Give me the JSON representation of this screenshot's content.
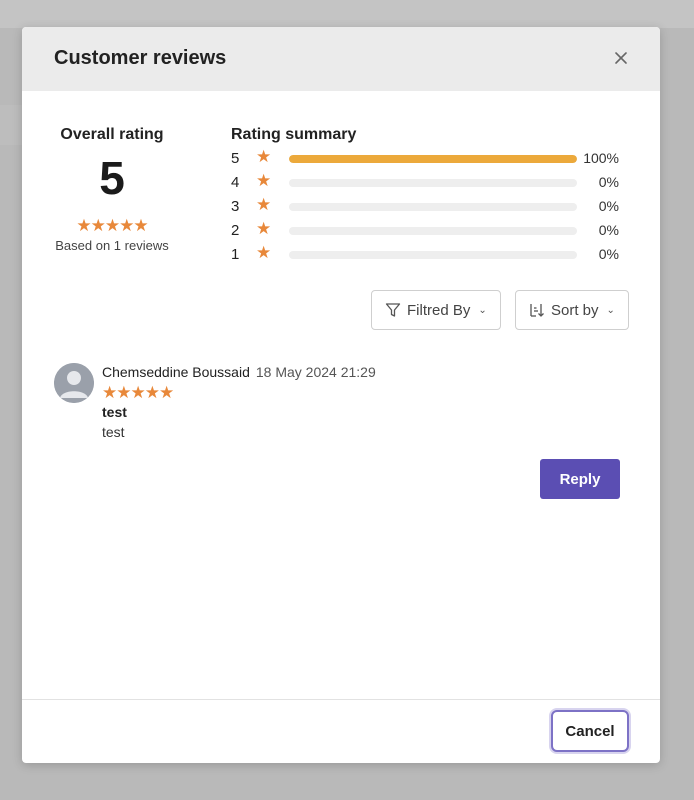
{
  "modal": {
    "title": "Customer reviews",
    "cancel_label": "Cancel"
  },
  "overall": {
    "label": "Overall rating",
    "value": "5",
    "stars": "★★★★★",
    "based_on": "Based on 1 reviews"
  },
  "summary": {
    "label": "Rating summary",
    "star_glyph": "★",
    "rows": [
      {
        "stars": "5",
        "fraction": 1.0,
        "percent": "100%"
      },
      {
        "stars": "4",
        "fraction": 0.0,
        "percent": "0%"
      },
      {
        "stars": "3",
        "fraction": 0.0,
        "percent": "0%"
      },
      {
        "stars": "2",
        "fraction": 0.0,
        "percent": "0%"
      },
      {
        "stars": "1",
        "fraction": 0.0,
        "percent": "0%"
      }
    ]
  },
  "toolbar": {
    "filter_label": "Filtred By",
    "sort_label": "Sort by"
  },
  "reviews": [
    {
      "author": "Chemseddine Boussaid",
      "date": "18 May 2024 21:29",
      "stars": "★★★★★",
      "title": "test",
      "text": "test",
      "reply_label": "Reply"
    }
  ],
  "colors": {
    "accent": "#5b4eb3",
    "star": "#e8883a",
    "bar_fill": "#eca93b"
  }
}
